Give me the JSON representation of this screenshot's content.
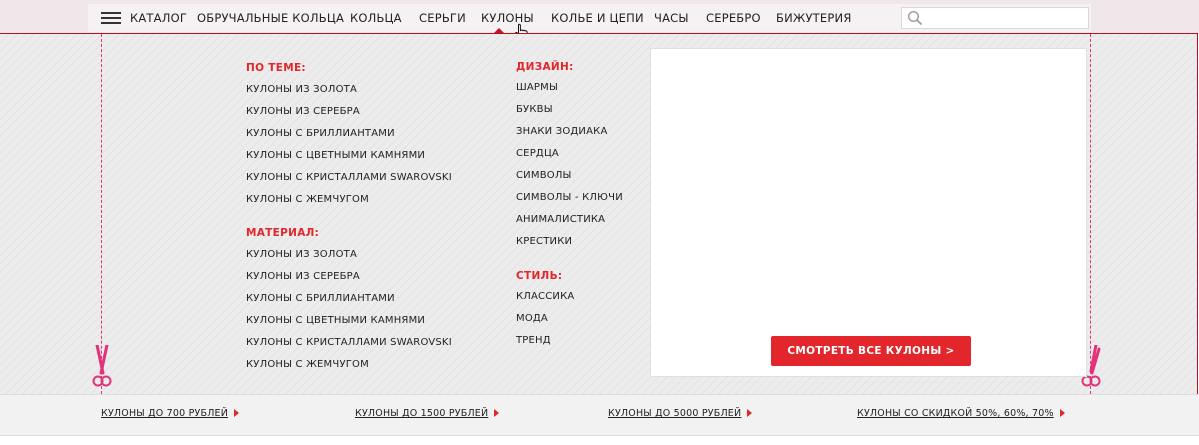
{
  "nav": {
    "catalog_label": "КАТАЛОГ",
    "items": [
      {
        "label": "ОБРУЧАЛЬНЫЕ КОЛЬЦА"
      },
      {
        "label": "КОЛЬЦА"
      },
      {
        "label": "СЕРЬГИ"
      },
      {
        "label": "КУЛОНЫ",
        "active": true
      },
      {
        "label": "КОЛЬЕ И ЦЕПИ"
      },
      {
        "label": "ЧАСЫ"
      },
      {
        "label": "СЕРЕБРО"
      },
      {
        "label": "БИЖУТЕРИЯ"
      }
    ],
    "search_placeholder": ""
  },
  "dropdown": {
    "theme": {
      "heading": "ПО ТЕМЕ:",
      "links": [
        "КУЛОНЫ ИЗ ЗОЛОТА",
        "КУЛОНЫ ИЗ СЕРЕБРА",
        "КУЛОНЫ С БРИЛЛИАНТАМИ",
        "КУЛОНЫ С ЦВЕТНЫМИ КАМНЯМИ",
        "КУЛОНЫ С КРИСТАЛЛАМИ SWAROVSKI",
        "КУЛОНЫ С ЖЕМЧУГОМ"
      ]
    },
    "material": {
      "heading": "МАТЕРИАЛ:",
      "links": [
        "КУЛОНЫ ИЗ ЗОЛОТА",
        "КУЛОНЫ ИЗ СЕРЕБРА",
        "КУЛОНЫ С БРИЛЛИАНТАМИ",
        "КУЛОНЫ С ЦВЕТНЫМИ КАМНЯМИ",
        "КУЛОНЫ С КРИСТАЛЛАМИ SWAROVSKI",
        "КУЛОНЫ С ЖЕМЧУГОМ"
      ]
    },
    "design": {
      "heading": "ДИЗАЙН:",
      "links": [
        "ШАРМЫ",
        "БУКВЫ",
        "ЗНАКИ ЗОДИАКА",
        "СЕРДЦА",
        "СИМВОЛЫ",
        "СИМВОЛЫ - КЛЮЧИ",
        "АНИМАЛИСТИКА",
        "КРЕСТИКИ"
      ]
    },
    "style": {
      "heading": "СТИЛЬ:",
      "links": [
        "КЛАССИКА",
        "МОДА",
        "ТРЕНД"
      ]
    },
    "promo_button": "СМОТРЕТЬ ВСЕ КУЛОНЫ >"
  },
  "price_bar": {
    "links": [
      "КУЛОНЫ ДО 700 РУБЛЕЙ",
      "КУЛОНЫ ДО 1500 РУБЛЕЙ",
      "КУЛОНЫ ДО 5000 РУБЛЕЙ",
      "КУЛОНЫ СО СКИДКОЙ 50%, 60%, 70%"
    ]
  },
  "colors": {
    "accent": "#e3262b",
    "border": "#b9121b",
    "cutline": "#e2327a"
  },
  "icons": [
    "hamburger-menu-icon",
    "search-icon",
    "hand-cursor-icon",
    "scissors-icon",
    "arrow-right-icon"
  ]
}
